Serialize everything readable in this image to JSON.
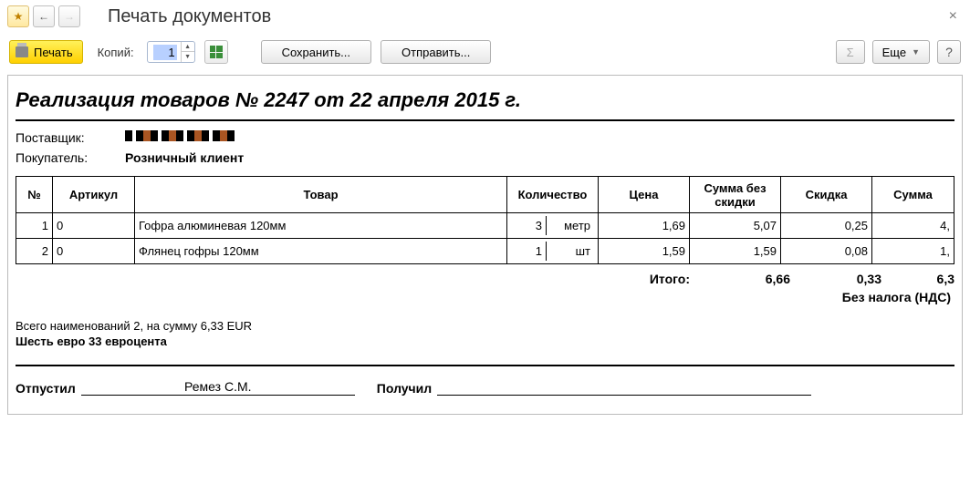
{
  "window": {
    "title": "Печать документов"
  },
  "toolbar": {
    "print_label": "Печать",
    "copies_label": "Копий:",
    "copies_value": "1",
    "save_label": "Сохранить...",
    "send_label": "Отправить...",
    "sigma": "Σ",
    "more_label": "Еще",
    "help": "?"
  },
  "document": {
    "title": "Реализация товаров № 2247 от 22 апреля 2015 г.",
    "supplier_label": "Поставщик:",
    "buyer_label": "Покупатель:",
    "buyer_value": "Розничный клиент",
    "columns": {
      "no": "№",
      "article": "Артикул",
      "name": "Товар",
      "qty": "Количество",
      "price": "Цена",
      "sum_nodisc": "Сумма без скидки",
      "discount": "Скидка",
      "sum": "Сумма"
    },
    "rows": [
      {
        "no": "1",
        "article": "0",
        "name": "Гофра алюминевая 120мм",
        "qty": "3",
        "unit": "метр",
        "price": "1,69",
        "sum_nodisc": "5,07",
        "discount": "0,25",
        "sum": "4,"
      },
      {
        "no": "2",
        "article": "0",
        "name": "Флянец гофры 120мм",
        "qty": "1",
        "unit": "шт",
        "price": "1,59",
        "sum_nodisc": "1,59",
        "discount": "0,08",
        "sum": "1,"
      }
    ],
    "totals": {
      "label": "Итого:",
      "sum_nodisc": "6,66",
      "discount": "0,33",
      "sum": "6,3",
      "novat": "Без налога (НДС)"
    },
    "summary_line": "Всего наименований 2, на сумму 6,33 EUR",
    "summary_words": "Шесть евро 33 евроцента",
    "released_label": "Отпустил",
    "released_name": "Ремез С.М.",
    "received_label": "Получил"
  }
}
